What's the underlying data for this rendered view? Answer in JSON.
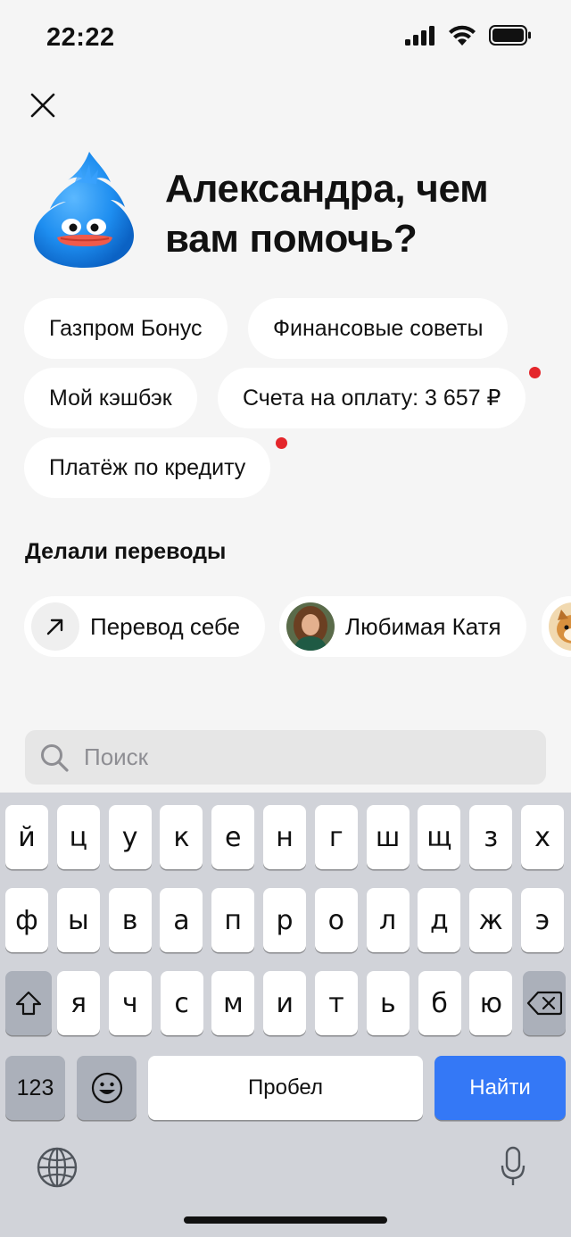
{
  "status_bar": {
    "time": "22:22"
  },
  "greeting": "Александра, чем вам помочь?",
  "chips": [
    {
      "label": "Газпром Бонус",
      "has_dot": false
    },
    {
      "label": "Финансовые советы",
      "has_dot": false
    },
    {
      "label": "Мой кэшбэк",
      "has_dot": false
    },
    {
      "label": "Счета на оплату: 3 657 ₽",
      "has_dot": true
    },
    {
      "label": "Платёж по кредиту",
      "has_dot": true
    }
  ],
  "transfers": {
    "title": "Делали переводы",
    "items": [
      {
        "label": "Перевод себе",
        "icon": "arrow-up-right-icon"
      },
      {
        "label": "Любимая Катя",
        "icon": "avatar-photo"
      },
      {
        "label": "",
        "icon": "dog-avatar"
      }
    ]
  },
  "search": {
    "placeholder": "Поиск",
    "value": ""
  },
  "keyboard": {
    "row1": [
      "й",
      "ц",
      "у",
      "к",
      "е",
      "н",
      "г",
      "ш",
      "щ",
      "з",
      "х"
    ],
    "row2": [
      "ф",
      "ы",
      "в",
      "а",
      "п",
      "р",
      "о",
      "л",
      "д",
      "ж",
      "э"
    ],
    "row3": [
      "я",
      "ч",
      "с",
      "м",
      "и",
      "т",
      "ь",
      "б",
      "ю"
    ],
    "numbers_label": "123",
    "space_label": "Пробел",
    "action_label": "Найти"
  },
  "colors": {
    "background": "#f5f5f5",
    "notification_dot": "#e4262b",
    "action_key": "#3478f6",
    "mascot": "#1e8ef0"
  }
}
